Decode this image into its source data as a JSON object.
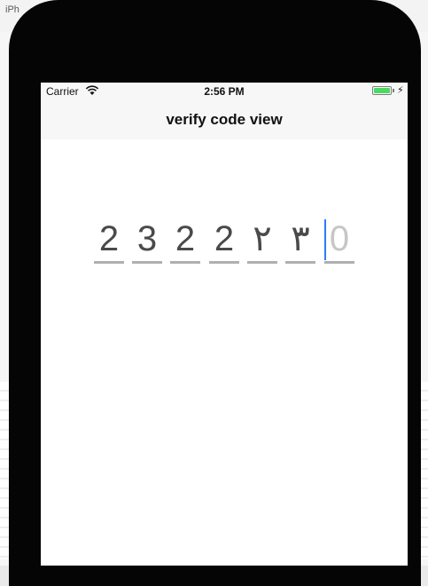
{
  "host": {
    "tab_label": "iPh"
  },
  "status_bar": {
    "carrier": "Carrier",
    "time": "2:56 PM",
    "battery_icon": "battery-full-icon",
    "wifi_icon": "wifi-icon"
  },
  "nav": {
    "title": "verify code view"
  },
  "code": {
    "digits": [
      "2",
      "3",
      "2",
      "2",
      "٢",
      "٣"
    ],
    "placeholder": "0",
    "accent_color": "#2f7cf6",
    "digit_color": "#4a4a4a",
    "placeholder_color": "#c6c6c6"
  }
}
